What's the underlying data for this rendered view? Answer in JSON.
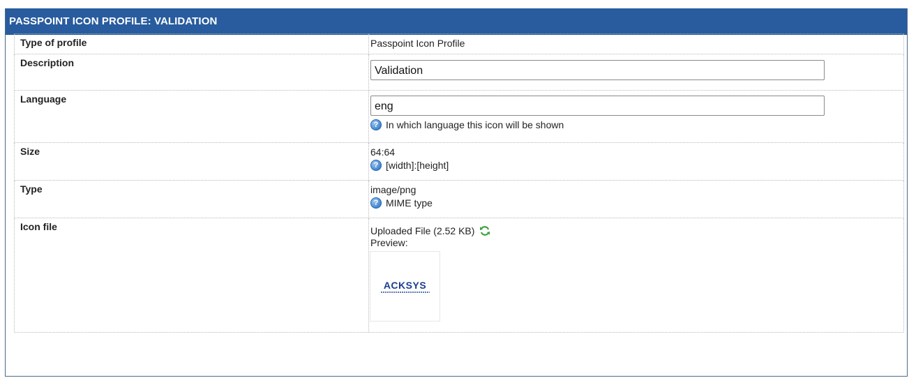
{
  "panel": {
    "title": "PASSPOINT ICON PROFILE: VALIDATION",
    "header_color": "#285c9e"
  },
  "rows": {
    "type_of_profile": {
      "label": "Type of profile",
      "value": "Passpoint Icon Profile"
    },
    "description": {
      "label": "Description",
      "value": "Validation"
    },
    "language": {
      "label": "Language",
      "value": "eng",
      "help": "In which language this icon will be shown"
    },
    "size": {
      "label": "Size",
      "value": "64:64",
      "help": "[width]:[height]"
    },
    "type": {
      "label": "Type",
      "value": "image/png",
      "help": "MIME type"
    },
    "icon_file": {
      "label": "Icon file",
      "uploaded": "Uploaded File (2.52 KB)",
      "preview_label": "Preview:",
      "preview_logo": "ACKSYS",
      "refresh_icon": "refresh-icon"
    }
  }
}
